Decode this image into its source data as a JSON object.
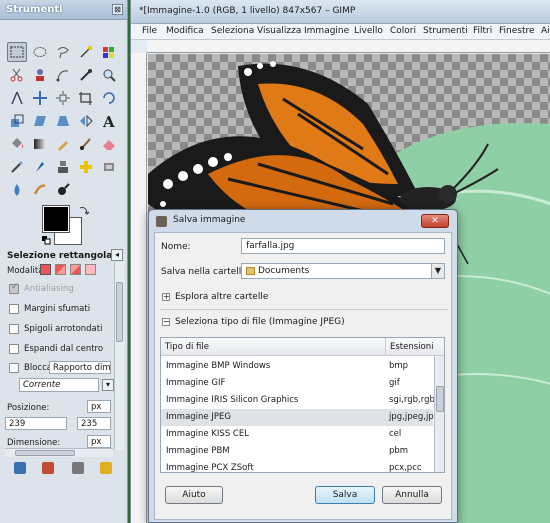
{
  "toolbox": {
    "title": "Strumenti",
    "close_glyph": "⊠",
    "options_title": "Selezione rettangolare",
    "mode_label": "Modalità:",
    "antialiasing": "Antialiasing",
    "feather": "Margini sfumati",
    "rounded": "Spigoli arrotondati",
    "expand_center": "Espandi dal centro",
    "lock_label": "Blocca:",
    "lock_value": "Rapporto dimensi",
    "current_value": "Corrente",
    "position_label": "Posizione:",
    "position_unit": "px",
    "position_x": "239",
    "position_y": "235",
    "dimension_label": "Dimensione:",
    "dimension_unit": "px"
  },
  "image_window": {
    "title": "*[Immagine-1.0 (RGB, 1 livello) 847x567 – GIMP",
    "menu": [
      {
        "label": "File"
      },
      {
        "label": "Modifica"
      },
      {
        "label": "Seleziona"
      },
      {
        "label": "Visualizza"
      },
      {
        "label": "Immagine"
      },
      {
        "label": "Livello"
      },
      {
        "label": "Colori"
      },
      {
        "label": "Strumenti"
      },
      {
        "label": "Filtri"
      },
      {
        "label": "Finestre"
      },
      {
        "label": "Aiu"
      }
    ]
  },
  "dialog": {
    "title": "Salva immagine",
    "close_glyph": "✕",
    "name_label": "Nome:",
    "name_value": "farfalla.jpg",
    "folder_label": "Salva nella cartella:",
    "folder_value": "Documents",
    "browse_label": "Esplora altre cartelle",
    "filetype_label": "Seleziona tipo di file (Immagine JPEG)",
    "col_type": "Tipo di file",
    "col_ext": "Estensioni",
    "rows": [
      {
        "type": "Immagine BMP Windows",
        "ext": "bmp"
      },
      {
        "type": "Immagine GIF",
        "ext": "gif"
      },
      {
        "type": "Immagine IRIS Silicon Graphics",
        "ext": "sgi,rgb,rgba"
      },
      {
        "type": "Immagine JPEG",
        "ext": "jpg,jpeg,jpe"
      },
      {
        "type": "Immagine KISS CEL",
        "ext": "cel"
      },
      {
        "type": "Immagine PBM",
        "ext": "pbm"
      },
      {
        "type": "Immagine PCX ZSoft",
        "ext": "pcx,pcc"
      }
    ],
    "help_button": "Aiuto",
    "save_button": "Salva",
    "cancel_button": "Annulla"
  },
  "colors": {
    "foreground": "#000000",
    "background": "#ffffff",
    "dialog_frame": "#cfdbe8",
    "close_red": "#c2412c"
  },
  "icons": [
    "rect-select-icon",
    "ellipse-select-icon",
    "lasso-icon",
    "fuzzy-select-icon",
    "scissors-icon",
    "zoom-icon",
    "paintbrush-icon",
    "text-icon",
    "eraser-icon",
    "bucket-fill-icon",
    "gradient-icon",
    "eyedropper-icon",
    "pencil-icon"
  ]
}
